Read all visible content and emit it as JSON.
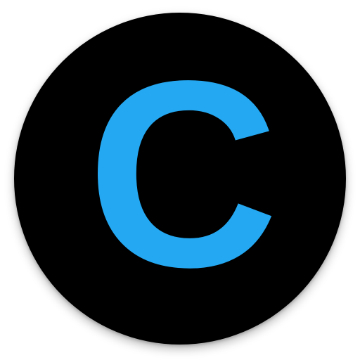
{
  "logo": {
    "letter": "C",
    "letter_color": "#24a8f2",
    "background_color": "#000000"
  }
}
